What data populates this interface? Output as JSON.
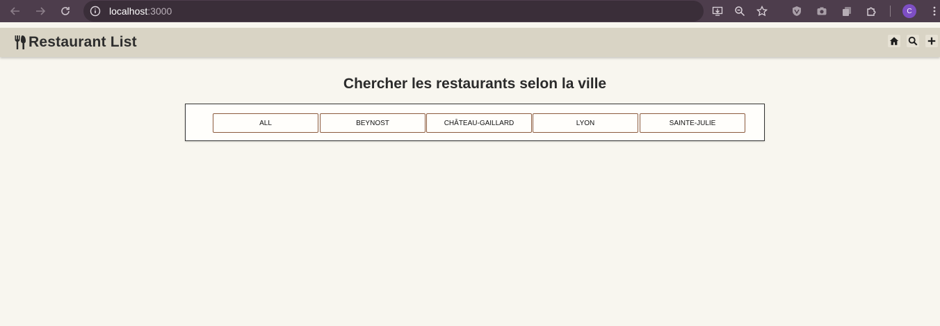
{
  "browser": {
    "url_host": "localhost",
    "url_port": ":3000",
    "profile_initial": "C",
    "icons": [
      "back-icon",
      "forward-icon",
      "reload-icon",
      "site-info-icon",
      "install-app-icon",
      "zoom-icon",
      "bookmark-star-icon",
      "shield-extension-icon",
      "camera-extension-icon",
      "copy-extension-icon",
      "extensions-puzzle-icon",
      "menu-dots-icon"
    ]
  },
  "header": {
    "title": "Restaurant List",
    "icons": [
      "utensils-icon",
      "home-icon",
      "search-icon",
      "plus-icon"
    ]
  },
  "main": {
    "heading": "Chercher les restaurants selon la ville",
    "cities": [
      "ALL",
      "BEYNOST",
      "CHÂTEAU-GAILLARD",
      "LYON",
      "SAINTE-JULIE"
    ]
  },
  "colors": {
    "chrome_bg": "#4d3d4c",
    "header_bg": "#d9d4c5",
    "page_bg": "#f8f6ef",
    "button_border": "#8b5a3c"
  }
}
